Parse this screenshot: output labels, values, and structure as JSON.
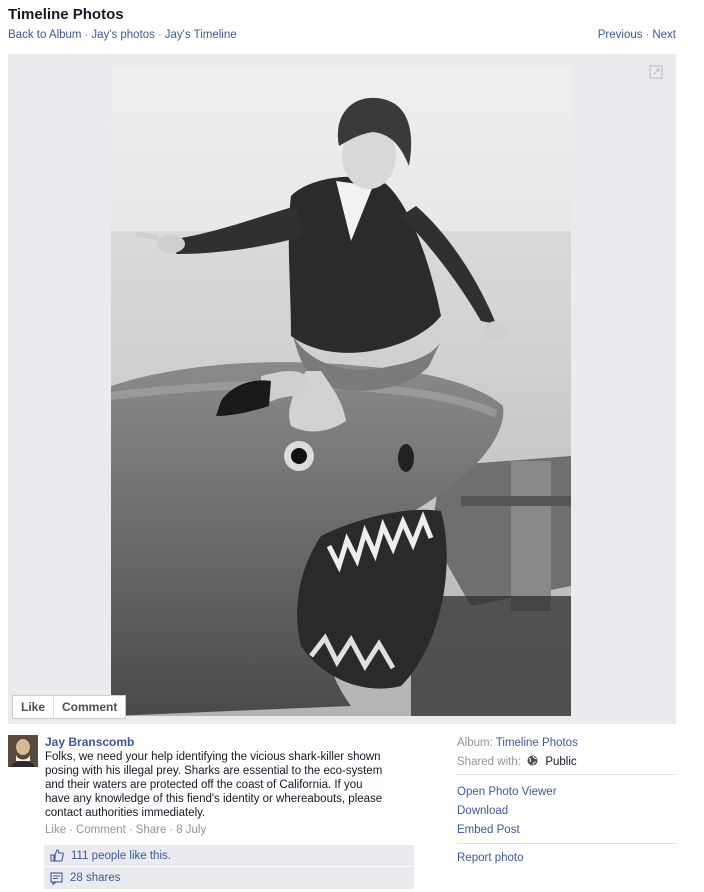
{
  "header": {
    "title": "Timeline Photos",
    "breadcrumbs": [
      "Back to Album",
      "Jay's photos",
      "Jay's Timeline"
    ],
    "pager": {
      "previous": "Previous",
      "next": "Next"
    }
  },
  "photo_actions": {
    "like": "Like",
    "comment": "Comment"
  },
  "post": {
    "author": "Jay Branscomb",
    "text": "Folks, we need your help identifying the vicious shark-killer shown posing with his illegal prey. Sharks are essential to the eco-system and their waters are protected off the coast of California. If you have any knowledge of this fiend's identity or whereabouts, please contact authorities immediately.",
    "actions": {
      "like": "Like",
      "comment": "Comment",
      "share": "Share",
      "date": "8 July"
    },
    "likes_text": "111 people like this.",
    "shares_text": "28 shares"
  },
  "sidebar": {
    "album_label": "Album:",
    "album_value": "Timeline Photos",
    "shared_label": "Shared with:",
    "shared_value": "Public",
    "links": [
      "Open Photo Viewer",
      "Download",
      "Embed Post",
      "Report photo"
    ]
  },
  "colors": {
    "link": "#3b5998",
    "muted": "#90949c",
    "stage_bg": "#e9ebee"
  },
  "icons": [
    "expand-icon",
    "globe-icon",
    "thumbs-up-icon",
    "share-icon"
  ]
}
